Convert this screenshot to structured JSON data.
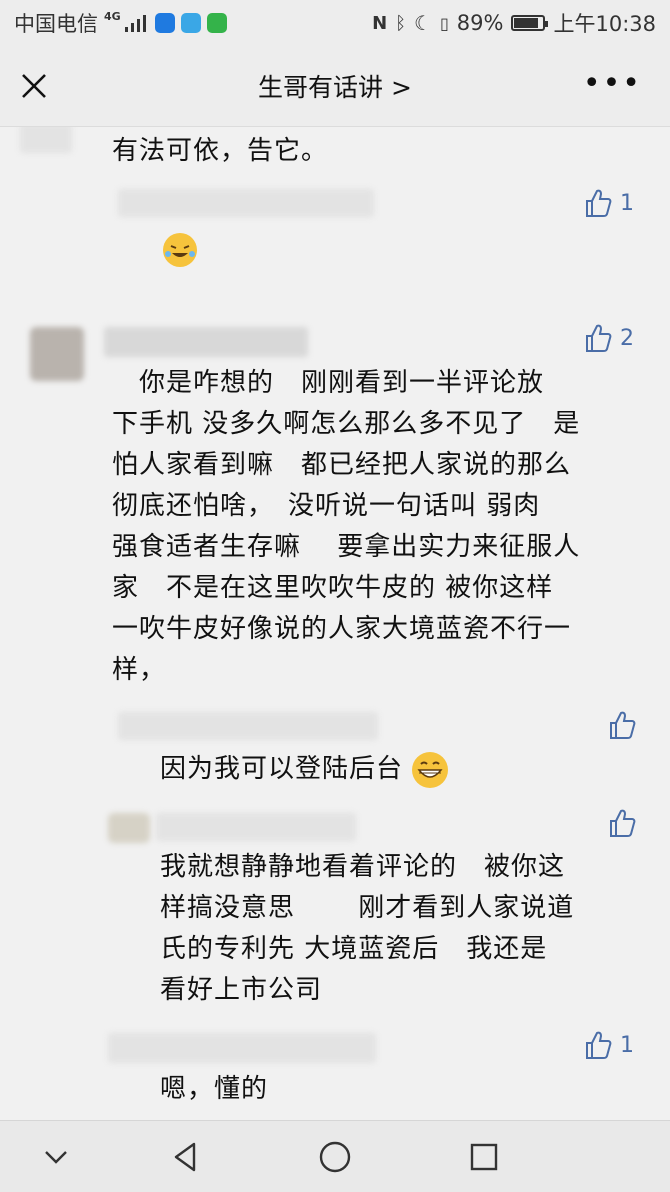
{
  "status_bar": {
    "carrier": "中国电信",
    "network": "4G",
    "battery": "89%",
    "battery_level": 0.89,
    "time": "上午10:38"
  },
  "nav": {
    "title": "生哥有话讲 >",
    "close_icon": "close-icon",
    "more_icon": "more-icon"
  },
  "comments": [
    {
      "text": "有法可依，告它。"
    },
    {
      "likes": "1",
      "emoji": "laughing-crying-emoji"
    },
    {
      "likes": "2",
      "lines": [
        "　你是咋想的　刚刚看到一半评论放",
        "下手机 没多久啊怎么那么多不见了　是",
        "怕人家看到嘛　都已经把人家说的那么",
        "彻底还怕啥，　没听说一句话叫 弱肉",
        "强食适者生存嘛　 要拿出实力来征服人",
        "家　不是在这里吹吹牛皮的 被你这样",
        "一吹牛皮好像说的人家大境蓝瓷不行一",
        "样，"
      ]
    }
  ],
  "replies": [
    {
      "text": "因为我可以登陆后台",
      "emoji": "grinning-emoji"
    },
    {
      "lines": [
        " 我就想静静地看着评论的　被你这",
        "样搞没意思　　 刚才看到人家说道",
        "氏的专利先 大境蓝瓷后　我还是",
        "看好上市公司"
      ]
    },
    {
      "likes": "1",
      "text": "嗯，懂的"
    }
  ],
  "bottom_nav": [
    "chevron-down-icon",
    "back-icon",
    "home-icon",
    "recents-icon"
  ],
  "colors": {
    "accent": "#4a6da7",
    "background": "#f1f1f1"
  }
}
